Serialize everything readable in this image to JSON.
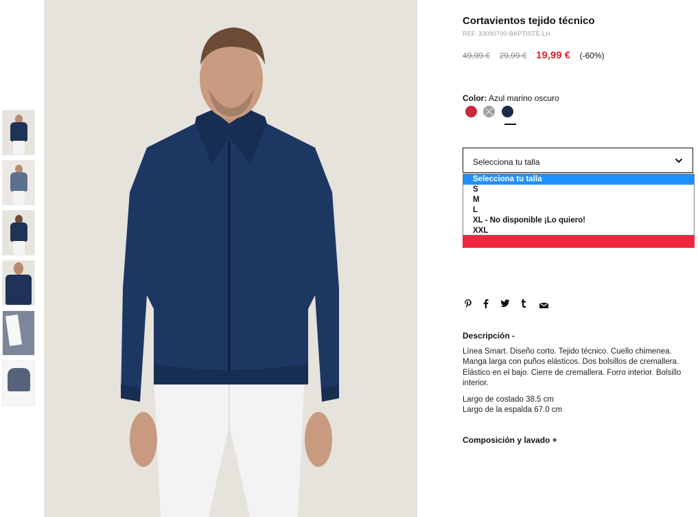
{
  "product": {
    "title": "Cortavientos tejido técnico",
    "ref": "REF. 33090700-BAPTISTE-LH",
    "price_old_1": "49,99 €",
    "price_old_2": "29,99 €",
    "price_new": "19,99 €",
    "discount": "(-60%)"
  },
  "color": {
    "label": "Color:",
    "value": "Azul marino oscuro",
    "swatches": [
      {
        "name": "red",
        "hex": "#c8293c",
        "available": true
      },
      {
        "name": "grey",
        "hex": "#9fa29d",
        "available": false
      },
      {
        "name": "navy",
        "hex": "#1d2b47",
        "available": true,
        "selected": true
      }
    ]
  },
  "size_select": {
    "label": "Selecciona tu talla",
    "options": [
      "Selecciona tu talla",
      "S",
      "M",
      "L",
      "XL - No disponible ¡Lo quiero!",
      "XXL"
    ],
    "selected_index": 0
  },
  "share_icons": [
    "pinterest-icon",
    "facebook-icon",
    "twitter-icon",
    "tumblr-icon",
    "email-icon"
  ],
  "description": {
    "heading": "Descripción  -",
    "text": "Línea Smart. Diseño corto. Tejido técnico. Cuello chimenea. Manga larga con puños elásticos. Dos bolsillos de cremallera. Elástico en el bajo. Cierre de cremallera. Forro interior. Bolsillo interior.",
    "measure_1": "Largo de costado 38.5 cm",
    "measure_2": "Largo de la espalda 67.0 cm"
  },
  "composition": {
    "heading": "Composición y lavado  +"
  },
  "colors": {
    "accent": "#f0263b",
    "price_red": "#e3212f",
    "highlight": "#1e90ff"
  }
}
